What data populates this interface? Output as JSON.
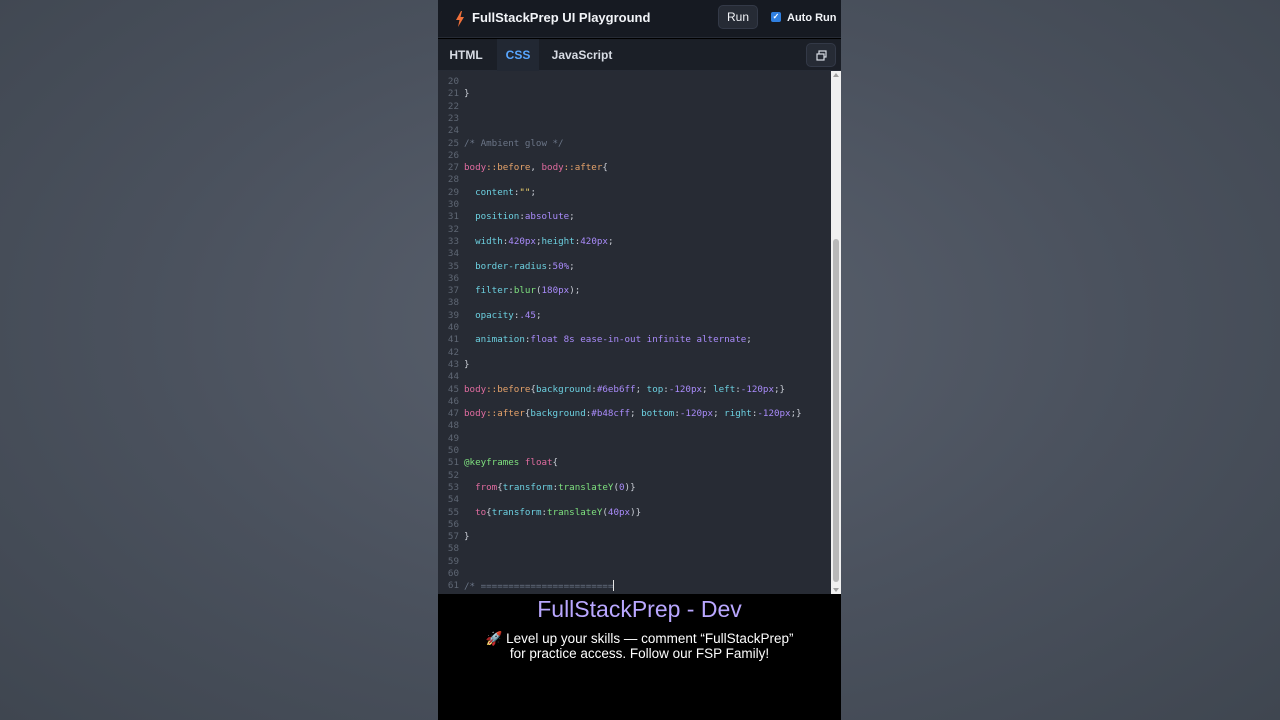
{
  "header": {
    "title": "FullStackPrep UI Playground",
    "run_label": "Run",
    "autorun_label": "Auto Run",
    "autorun_checked": true,
    "icon": "bolt-icon",
    "expand_icon": "restore-window-icon"
  },
  "tabs": [
    {
      "label": "HTML",
      "active": false
    },
    {
      "label": "CSS",
      "active": true
    },
    {
      "label": "JavaScript",
      "active": false
    }
  ],
  "colors": {
    "accent": "#58a6ff",
    "brand": "#b9a7ff",
    "editor_bg": "#272b34",
    "selector": "#e06c9f",
    "property": "#6cd0e0",
    "value": "#a98bfa",
    "function": "#7ee07e",
    "string": "#f5d76e",
    "comment": "#6b7587"
  },
  "editor": {
    "language": "css",
    "lines": [
      {
        "n": "20",
        "code": ""
      },
      {
        "n": "21",
        "code": "}"
      },
      {
        "n": "22",
        "code": ""
      },
      {
        "n": "23",
        "code": ""
      },
      {
        "n": "24",
        "code": ""
      },
      {
        "n": "25",
        "code": "/* Ambient glow */"
      },
      {
        "n": "26",
        "code": ""
      },
      {
        "n": "27",
        "code": "body::before, body::after{"
      },
      {
        "n": "28",
        "code": ""
      },
      {
        "n": "29",
        "code": "  content:\"\";"
      },
      {
        "n": "30",
        "code": ""
      },
      {
        "n": "31",
        "code": "  position:absolute;"
      },
      {
        "n": "32",
        "code": ""
      },
      {
        "n": "33",
        "code": "  width:420px;height:420px;"
      },
      {
        "n": "34",
        "code": ""
      },
      {
        "n": "35",
        "code": "  border-radius:50%;"
      },
      {
        "n": "36",
        "code": ""
      },
      {
        "n": "37",
        "code": "  filter:blur(180px);"
      },
      {
        "n": "38",
        "code": ""
      },
      {
        "n": "39",
        "code": "  opacity:.45;"
      },
      {
        "n": "40",
        "code": ""
      },
      {
        "n": "41",
        "code": "  animation:float 8s ease-in-out infinite alternate;"
      },
      {
        "n": "42",
        "code": ""
      },
      {
        "n": "43",
        "code": "}"
      },
      {
        "n": "44",
        "code": ""
      },
      {
        "n": "45",
        "code": "body::before{background:#6eb6ff; top:-120px; left:-120px;}"
      },
      {
        "n": "46",
        "code": ""
      },
      {
        "n": "47",
        "code": "body::after{background:#b48cff; bottom:-120px; right:-120px;}"
      },
      {
        "n": "48",
        "code": ""
      },
      {
        "n": "49",
        "code": ""
      },
      {
        "n": "50",
        "code": ""
      },
      {
        "n": "51",
        "code": "@keyframes float{"
      },
      {
        "n": "52",
        "code": ""
      },
      {
        "n": "53",
        "code": "  from{transform:translateY(0)}"
      },
      {
        "n": "54",
        "code": ""
      },
      {
        "n": "55",
        "code": "  to{transform:translateY(40px)}"
      },
      {
        "n": "56",
        "code": ""
      },
      {
        "n": "57",
        "code": "}"
      },
      {
        "n": "58",
        "code": ""
      },
      {
        "n": "59",
        "code": ""
      },
      {
        "n": "60",
        "code": ""
      },
      {
        "n": "61",
        "code": "/* ========================"
      }
    ],
    "cursor_line": "61",
    "scroll_position": 0.47
  },
  "caption": {
    "brand": "FullStackPrep - Dev",
    "line1": "🚀 Level up your skills — comment “FullStackPrep”",
    "line2": "for practice access. Follow our FSP Family!"
  }
}
